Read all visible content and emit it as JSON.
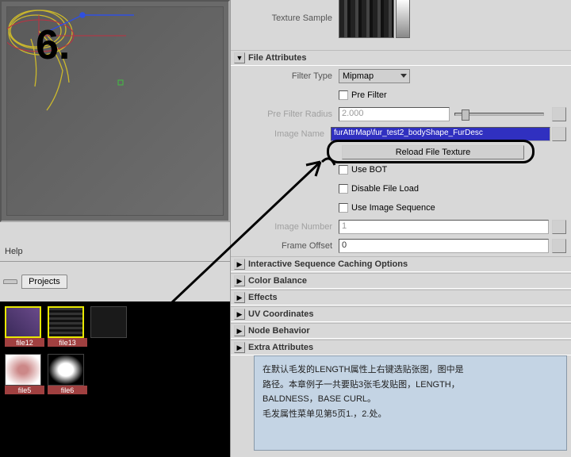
{
  "viewport": {
    "big_number": "6."
  },
  "menu": {
    "help": "Help"
  },
  "tabs": {
    "left": "",
    "projects": "Projects"
  },
  "thumbs": [
    {
      "label": "file12"
    },
    {
      "label": "file13"
    },
    {
      "label": ""
    },
    {
      "label": "file5"
    },
    {
      "label": "file6"
    }
  ],
  "right": {
    "texture_sample": "Texture Sample",
    "file_attributes": "File Attributes",
    "filter_type": "Filter Type",
    "filter_value": "Mipmap",
    "pre_filter": "Pre Filter",
    "pre_filter_radius": "Pre Filter Radius",
    "pre_filter_radius_val": "2.000",
    "image_name": "Image Name",
    "image_name_val": "furAttrMap\\fur_test2_bodyShape_FurDesc",
    "reload": "Reload File Texture",
    "use_bot": "Use BOT",
    "disable_load": "Disable File Load",
    "use_seq": "Use Image Sequence",
    "image_number": "Image Number",
    "image_number_val": "1",
    "frame_offset": "Frame Offset",
    "frame_offset_val": "0",
    "sections": {
      "iscache": "Interactive Sequence Caching Options",
      "color_balance": "Color Balance",
      "effects": "Effects",
      "uv": "UV Coordinates",
      "node_behavior": "Node Behavior",
      "extra": "Extra Attributes"
    }
  },
  "note": {
    "l1": "在默认毛发的LENGTH属性上右键选贴张图，图中是",
    "l2": "路径。本章例子一共要贴3张毛发贴图，LENGTH，",
    "l3": "BALDNESS，BASE CURL。",
    "l4": "毛发属性菜单见第5页1.，2.处。"
  }
}
